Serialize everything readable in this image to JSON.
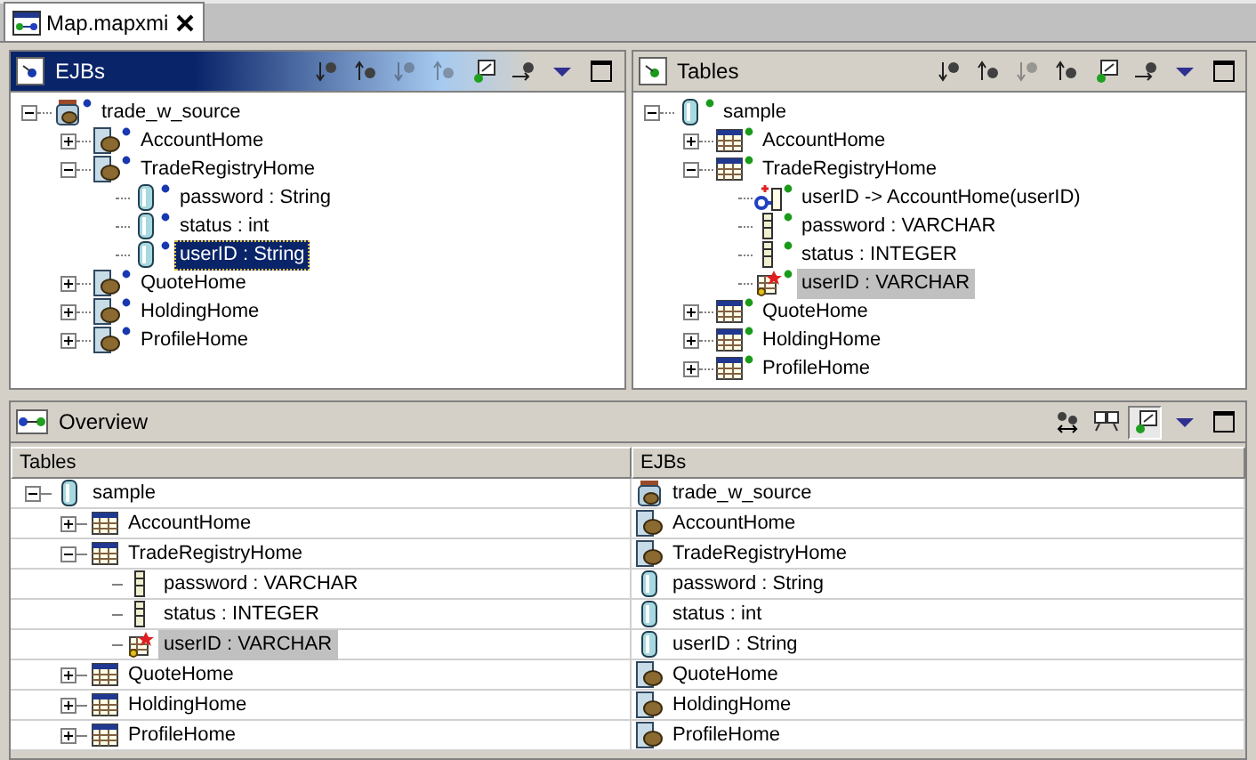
{
  "editor_tab": {
    "title": "Map.mapxmi",
    "selected": true
  },
  "ejbs_pane": {
    "kind": "ejb",
    "title": "EJBs",
    "active": true,
    "toolbar": [
      {
        "kind": "down",
        "disabled": false
      },
      {
        "kind": "up",
        "disabled": false
      },
      {
        "kind": "down",
        "disabled": true
      },
      {
        "kind": "up",
        "disabled": true
      },
      {
        "kind": "check",
        "disabled": false
      },
      {
        "kind": "link",
        "disabled": false
      },
      {
        "kind": "menu",
        "disabled": false
      },
      {
        "kind": "maximize",
        "disabled": false
      }
    ],
    "tree": [
      {
        "label": "trade_w_source",
        "kind": "jar",
        "expanded": true,
        "selected": false,
        "children": [
          {
            "label": "AccountHome",
            "kind": "bean",
            "expanded": false,
            "selected": false
          },
          {
            "label": "TradeRegistryHome",
            "kind": "bean",
            "expanded": true,
            "selected": false,
            "children": [
              {
                "label": "password : String",
                "kind": "attribute",
                "selected": false
              },
              {
                "label": "status : int",
                "kind": "attribute",
                "selected": false
              },
              {
                "label": "userID : String",
                "kind": "attribute",
                "selected": true
              }
            ]
          },
          {
            "label": "QuoteHome",
            "kind": "bean",
            "expanded": false,
            "selected": false
          },
          {
            "label": "HoldingHome",
            "kind": "bean",
            "expanded": false,
            "selected": false
          },
          {
            "label": "ProfileHome",
            "kind": "bean",
            "expanded": false,
            "selected": false
          }
        ]
      }
    ]
  },
  "tables_pane": {
    "kind": "table",
    "title": "Tables",
    "active": false,
    "toolbar": [
      {
        "kind": "down",
        "disabled": false
      },
      {
        "kind": "up",
        "disabled": false
      },
      {
        "kind": "down",
        "disabled": true
      },
      {
        "kind": "up",
        "disabled": false
      },
      {
        "kind": "check",
        "disabled": false
      },
      {
        "kind": "link",
        "disabled": false
      },
      {
        "kind": "menu",
        "disabled": false
      },
      {
        "kind": "maximize",
        "disabled": false
      }
    ],
    "tree": [
      {
        "label": "sample",
        "kind": "database",
        "expanded": true,
        "selected": false,
        "children": [
          {
            "label": "AccountHome",
            "kind": "table",
            "expanded": false,
            "selected": false
          },
          {
            "label": "TradeRegistryHome",
            "kind": "table",
            "expanded": true,
            "selected": false,
            "children": [
              {
                "label": "userID -> AccountHome(userID)",
                "kind": "foreign_key",
                "selected": false
              },
              {
                "label": "password : VARCHAR",
                "kind": "column",
                "selected": false
              },
              {
                "label": "status : INTEGER",
                "kind": "column",
                "selected": false
              },
              {
                "label": "userID : VARCHAR",
                "kind": "key_column",
                "selected": true
              }
            ]
          },
          {
            "label": "QuoteHome",
            "kind": "table",
            "expanded": false,
            "selected": false
          },
          {
            "label": "HoldingHome",
            "kind": "table",
            "expanded": false,
            "selected": false
          },
          {
            "label": "ProfileHome",
            "kind": "table",
            "expanded": false,
            "selected": false
          }
        ]
      }
    ]
  },
  "overview": {
    "title": "Overview",
    "toolbar": [
      {
        "kind": "swap",
        "pressed": false
      },
      {
        "kind": "compare",
        "pressed": false
      },
      {
        "kind": "check",
        "pressed": true
      },
      {
        "kind": "menu",
        "pressed": false
      },
      {
        "kind": "maximize",
        "pressed": false
      }
    ],
    "columns": [
      "Tables",
      "EJBs"
    ],
    "rows": [
      {
        "table": {
          "label": "sample",
          "kind": "database"
        },
        "ejb": {
          "label": "trade_w_source",
          "kind": "jar"
        },
        "expanded": true,
        "selected": false,
        "children": [
          {
            "table": {
              "label": "AccountHome",
              "kind": "table"
            },
            "ejb": {
              "label": "AccountHome",
              "kind": "bean"
            },
            "expanded": false,
            "selected": false
          },
          {
            "table": {
              "label": "TradeRegistryHome",
              "kind": "table"
            },
            "ejb": {
              "label": "TradeRegistryHome",
              "kind": "bean"
            },
            "expanded": true,
            "selected": false,
            "children": [
              {
                "table": {
                  "label": "password : VARCHAR",
                  "kind": "column"
                },
                "ejb": {
                  "label": "password : String",
                  "kind": "attribute"
                },
                "selected": false
              },
              {
                "table": {
                  "label": "status : INTEGER",
                  "kind": "column"
                },
                "ejb": {
                  "label": "status : int",
                  "kind": "attribute"
                },
                "selected": false
              },
              {
                "table": {
                  "label": "userID : VARCHAR",
                  "kind": "key_column"
                },
                "ejb": {
                  "label": "userID : String",
                  "kind": "attribute"
                },
                "selected": true
              }
            ]
          },
          {
            "table": {
              "label": "QuoteHome",
              "kind": "table"
            },
            "ejb": {
              "label": "QuoteHome",
              "kind": "bean"
            },
            "expanded": false,
            "selected": false
          },
          {
            "table": {
              "label": "HoldingHome",
              "kind": "table"
            },
            "ejb": {
              "label": "HoldingHome",
              "kind": "bean"
            },
            "expanded": false,
            "selected": false
          },
          {
            "table": {
              "label": "ProfileHome",
              "kind": "table"
            },
            "ejb": {
              "label": "ProfileHome",
              "kind": "bean"
            },
            "expanded": false,
            "selected": false
          }
        ]
      }
    ]
  }
}
